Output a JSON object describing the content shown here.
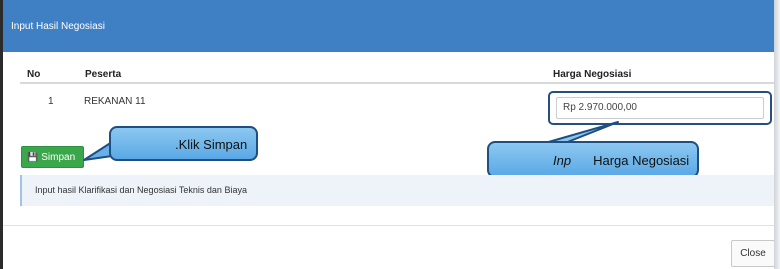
{
  "dialog": {
    "title": "Input Hasil Negosiasi"
  },
  "table": {
    "headers": {
      "no": "No",
      "peserta": "Peserta",
      "harga": "Harga Negosiasi"
    },
    "rows": [
      {
        "no": "1",
        "peserta": "REKANAN 11",
        "harga": "Rp 2.970.000,00"
      }
    ]
  },
  "actions": {
    "save_label": "Simpan",
    "save_icon": "floppy-disk-icon",
    "close_label": "Close",
    "save_color": "#3aa84a"
  },
  "info": {
    "text": "Input hasil Klarifikasi dan Negosiasi Teknis dan Biaya"
  },
  "annotations": {
    "klik_simpan": ".Klik Simpan",
    "inp_prefix": "Inp",
    "inp_rest": "Harga Negosiasi"
  },
  "colors": {
    "header": "#3f7fc3",
    "callout": "#6fb6ea",
    "callout_border": "#1e4f80"
  }
}
